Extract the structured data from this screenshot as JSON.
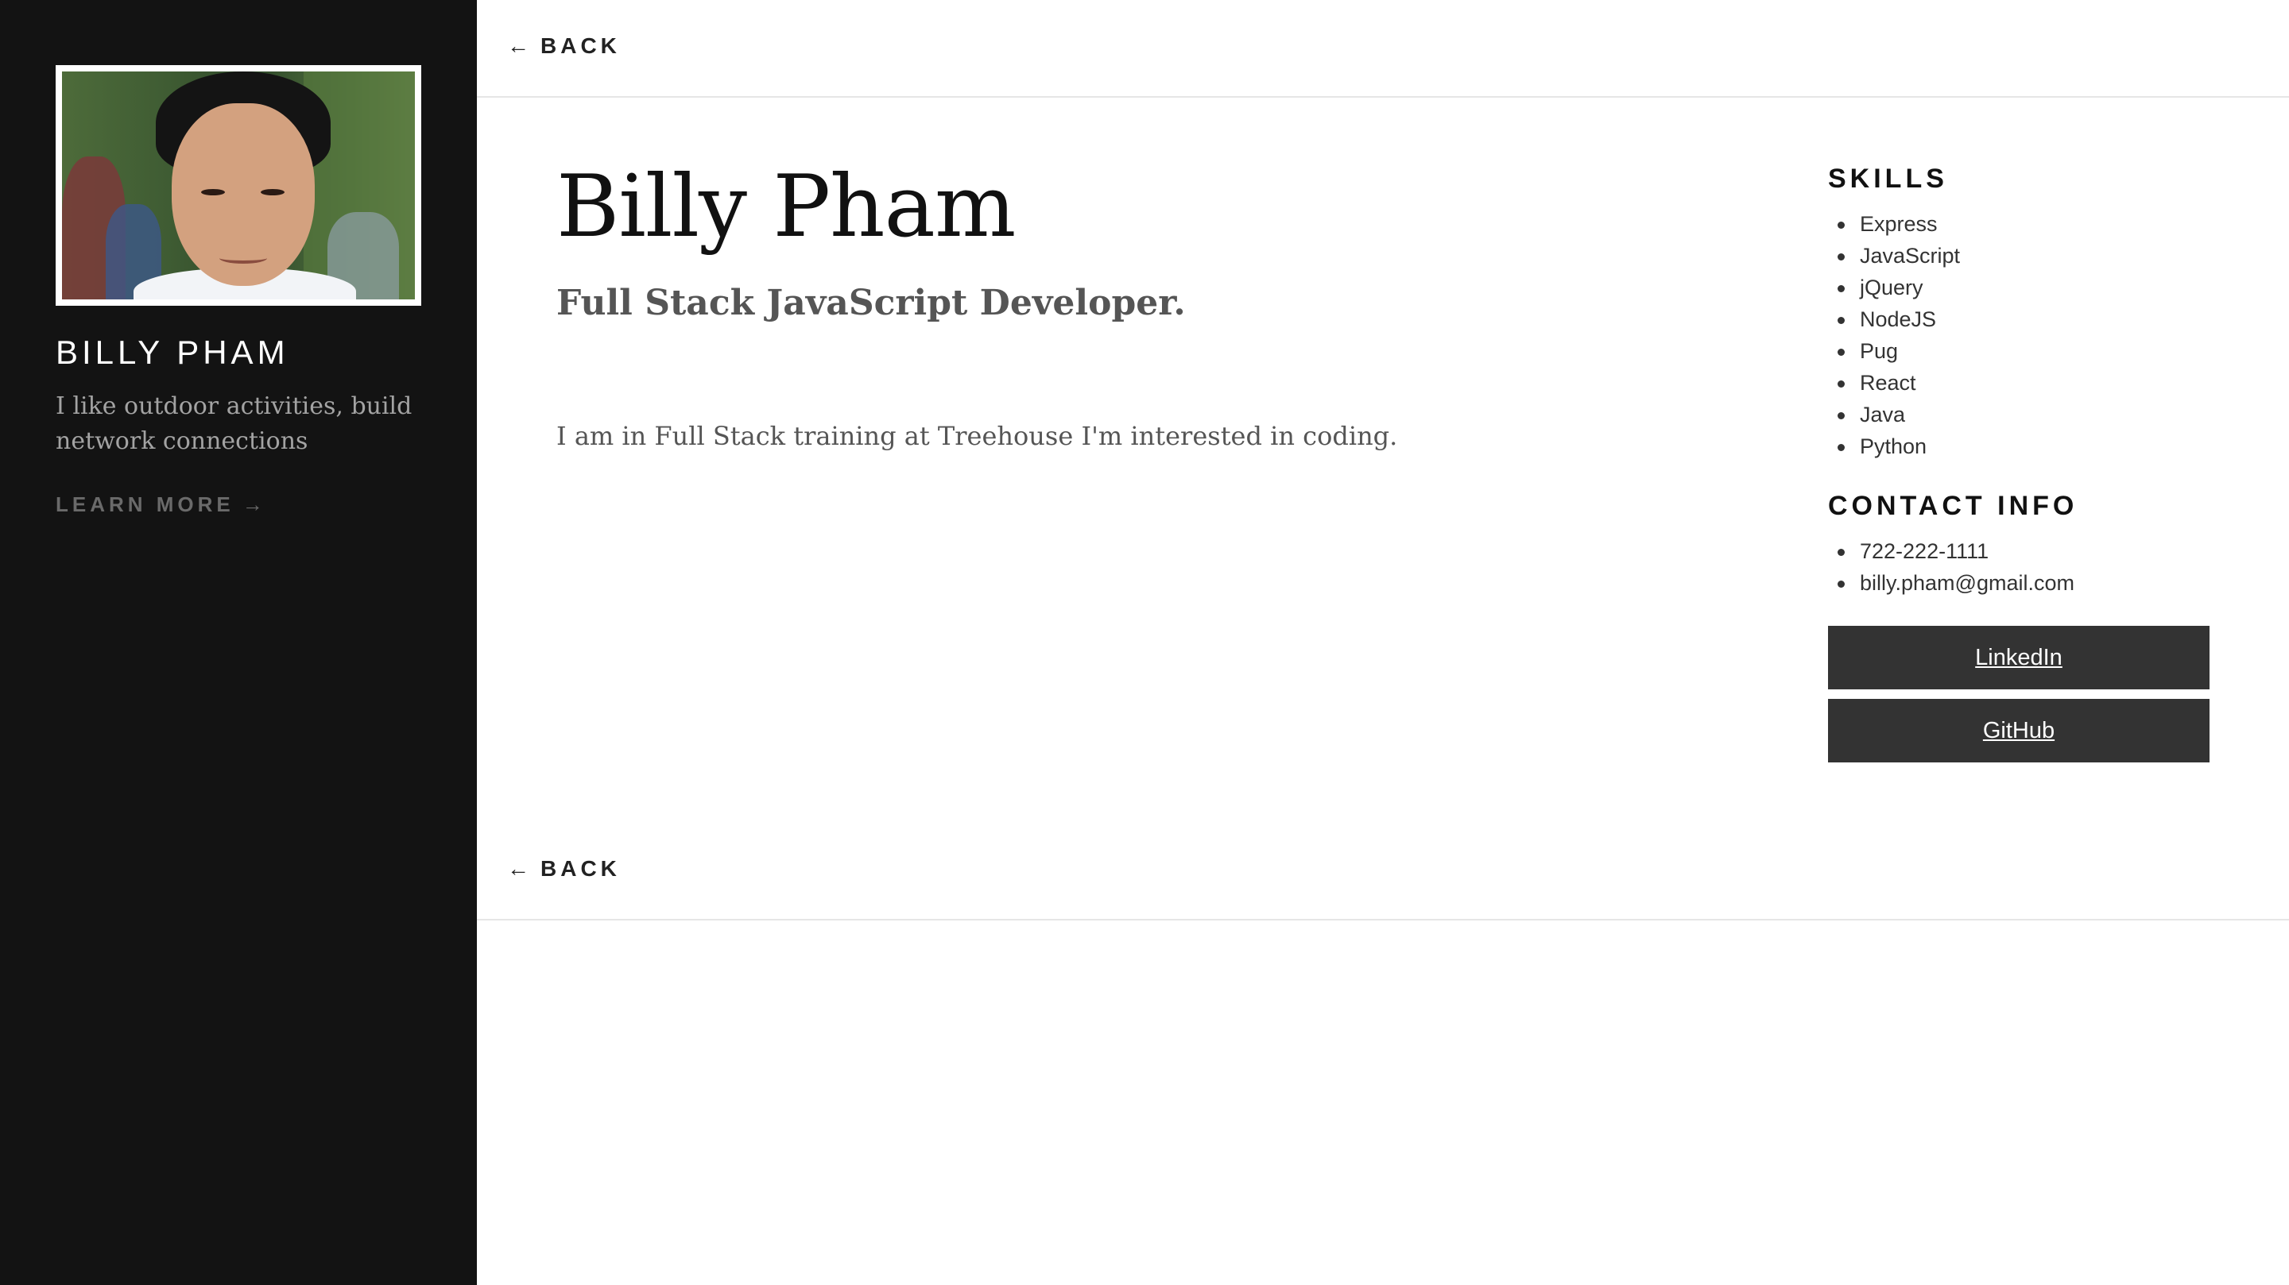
{
  "sidebar": {
    "name": "BILLY PHAM",
    "bio": "I like outdoor activities, build network connections",
    "learn_more": "LEARN MORE",
    "learn_more_arrow": "→"
  },
  "nav": {
    "back_label": "BACK",
    "back_arrow": "←"
  },
  "profile": {
    "name": "Billy Pham",
    "title": "Full Stack JavaScript Developer.",
    "description": "I am in Full Stack training at Treehouse I'm interested in coding."
  },
  "skills": {
    "heading": "SKILLS",
    "items": [
      "Express",
      "JavaScript",
      "jQuery",
      "NodeJS",
      "Pug",
      "React",
      "Java",
      "Python"
    ]
  },
  "contact": {
    "heading": "CONTACT INFO",
    "items": [
      "722-222-1111",
      "billy.pham@gmail.com"
    ]
  },
  "buttons": {
    "linkedin": "LinkedIn",
    "github": "GitHub"
  },
  "colors": {
    "sidebar_bg": "#131313",
    "button_bg": "#333333"
  }
}
